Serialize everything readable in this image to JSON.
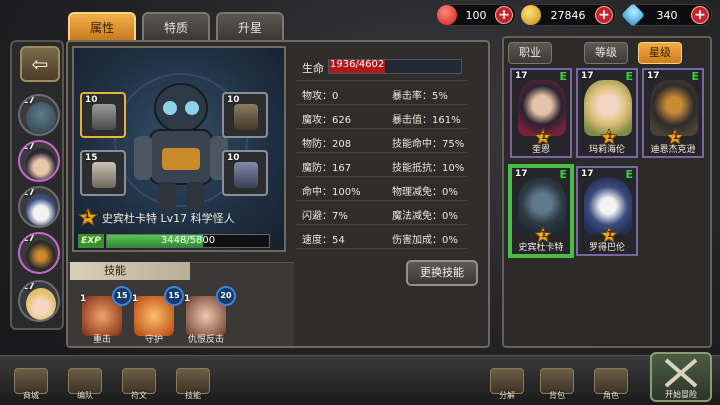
{
  "currency": {
    "hearts": "100",
    "gold": "27846",
    "gems": "340"
  },
  "colors": {
    "accent_orange": "#e99a33",
    "hp_red": "#b0181c",
    "exp_green": "#3fae3f",
    "card_purple": "#7a66a2",
    "card_green": "#4fb84b"
  },
  "strip_heroes": [
    {
      "level": "17",
      "icon": "robot-hero-icon"
    },
    {
      "level": "17",
      "icon": "dark-hair-hero-icon"
    },
    {
      "level": "17",
      "icon": "wolf-hero-icon"
    },
    {
      "level": "17",
      "icon": "armored-hero-icon"
    },
    {
      "level": "17",
      "icon": "blonde-hero-icon"
    }
  ],
  "tabs": [
    {
      "label": "属性",
      "active": true
    },
    {
      "label": "特质",
      "active": false
    },
    {
      "label": "升星",
      "active": false
    }
  ],
  "equipment": [
    {
      "count": "10",
      "icon": "gauntlet-icon"
    },
    {
      "count": "10",
      "icon": "belt-icon"
    },
    {
      "count": "15",
      "icon": "armor-icon"
    },
    {
      "count": "10",
      "icon": "boots-icon"
    }
  ],
  "hero": {
    "star": "1",
    "name_line": "史宾杜卡特   Lv17   科学怪人",
    "exp_label": "EXP",
    "exp_text": "3448/5800",
    "exp_fraction": 0.594
  },
  "stats": {
    "hp_label": "生命",
    "hp_text": "1936/4602",
    "hp_fraction": 0.421,
    "rows": [
      [
        "物攻：0",
        "暴击率：5%"
      ],
      [
        "魔攻：626",
        "暴击值：161%"
      ],
      [
        "物防：208",
        "技能命中：75%"
      ],
      [
        "魔防：167",
        "技能抵抗：10%"
      ],
      [
        "命中：100%",
        "物理减免：0%"
      ],
      [
        "闪避：7%",
        "魔法减免：0%"
      ],
      [
        "速度：54",
        "伤害加成：0%"
      ]
    ]
  },
  "change_skill_label": "更换技能",
  "skills": {
    "title": "技能",
    "items": [
      {
        "level": "1",
        "points": "15",
        "name": "重击"
      },
      {
        "level": "1",
        "points": "15",
        "name": "守护"
      },
      {
        "level": "1",
        "points": "20",
        "name": "仇恨反击"
      }
    ]
  },
  "roster": {
    "tabs": [
      {
        "label": "职业",
        "active": false
      },
      {
        "label": "等级",
        "active": false
      },
      {
        "label": "星级",
        "active": true
      }
    ],
    "cards": [
      {
        "level": "17",
        "badge": "E",
        "star": "1",
        "name": "奎恩"
      },
      {
        "level": "17",
        "badge": "E",
        "star": "1",
        "name": "玛莉海伦"
      },
      {
        "level": "17",
        "badge": "E",
        "star": "1",
        "name": "迪恩杰克逊"
      },
      {
        "level": "17",
        "badge": "E",
        "star": "1",
        "name": "史宾杜卡特"
      },
      {
        "level": "17",
        "badge": "E",
        "star": "1",
        "name": "罗得巴伦"
      }
    ]
  },
  "nav": [
    {
      "label": "商城",
      "icon": "shop-icon"
    },
    {
      "label": "编队",
      "icon": "team-icon"
    },
    {
      "label": "符文",
      "icon": "rune-icon"
    },
    {
      "label": "技能",
      "icon": "skill-book-icon"
    },
    {
      "label": "分解",
      "icon": "disassemble-icon"
    },
    {
      "label": "背包",
      "icon": "backpack-icon"
    },
    {
      "label": "角色",
      "icon": "character-icon"
    }
  ],
  "start_label": "开始冒险"
}
